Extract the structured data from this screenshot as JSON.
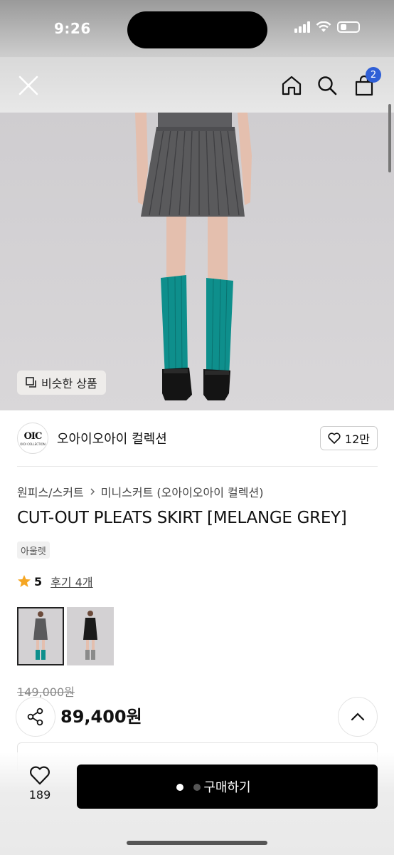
{
  "status_bar": {
    "time": "9:26"
  },
  "nav": {
    "cart_count": "2"
  },
  "hero": {
    "similar_label": "비슷한 상품"
  },
  "brand": {
    "logo_mark": "OIC",
    "logo_sub": "OIOI COLLECTION",
    "name": "오아이오아이 컬렉션",
    "likes": "12만"
  },
  "breadcrumb": {
    "category": "원피스/스커트",
    "sub_category": "미니스커트 (오아이오아이 컬렉션)"
  },
  "product": {
    "title": "CUT-OUT PLEATS SKIRT [MELANGE GREY]",
    "tag": "아울렛",
    "rating": "5",
    "review_label": "후기 4개",
    "original_price": "149,000원",
    "sale_price": "89,400원"
  },
  "bottom": {
    "wish_count": "189",
    "buy_label": "구매하기"
  },
  "colors": {
    "accent": "#2f5fd6",
    "sock": "#0e8f8c",
    "skirt": "#5a5a5c",
    "star": "#f5a623"
  }
}
